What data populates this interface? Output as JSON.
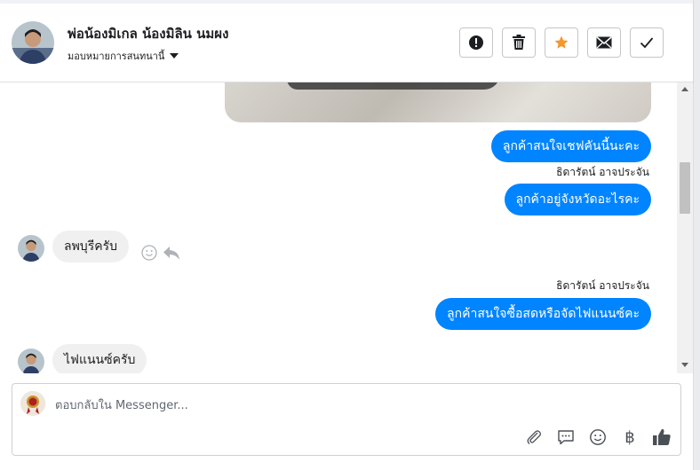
{
  "header": {
    "name": "พ่อน้องมิเกล น้องมิลิน นมผง",
    "assign_label": "มอบหมายการสนทนานี้",
    "actions": {
      "spam_icon": "exclamation-circle-icon",
      "delete_icon": "trash-icon",
      "star_icon": "star-icon",
      "mail_icon": "envelope-icon",
      "done_icon": "check-icon"
    }
  },
  "messages": [
    {
      "direction": "out",
      "text": "ลูกค้าสนใจเชฟคันนี้นะคะ"
    },
    {
      "direction": "out",
      "sender": "ธิดารัตน์ อาจประจัน",
      "text": "ลูกค้าอยู่จังหวัดอะไรคะ"
    },
    {
      "direction": "in",
      "text": "ลพบุรีครับ"
    },
    {
      "direction": "out",
      "sender": "ธิดารัตน์ อาจประจัน",
      "text": "ลูกค้าสนใจซื้อสดหรือจัดไฟแนนซ์คะ"
    },
    {
      "direction": "in",
      "text": "ไฟแนนซ์ครับ"
    }
  ],
  "composer": {
    "placeholder": "ตอบกลับใน Messenger...",
    "value": "",
    "currency_symbol": "฿"
  },
  "colors": {
    "accent": "#0084ff",
    "star": "#f5962e",
    "incoming_bubble": "#f1f0f0"
  }
}
